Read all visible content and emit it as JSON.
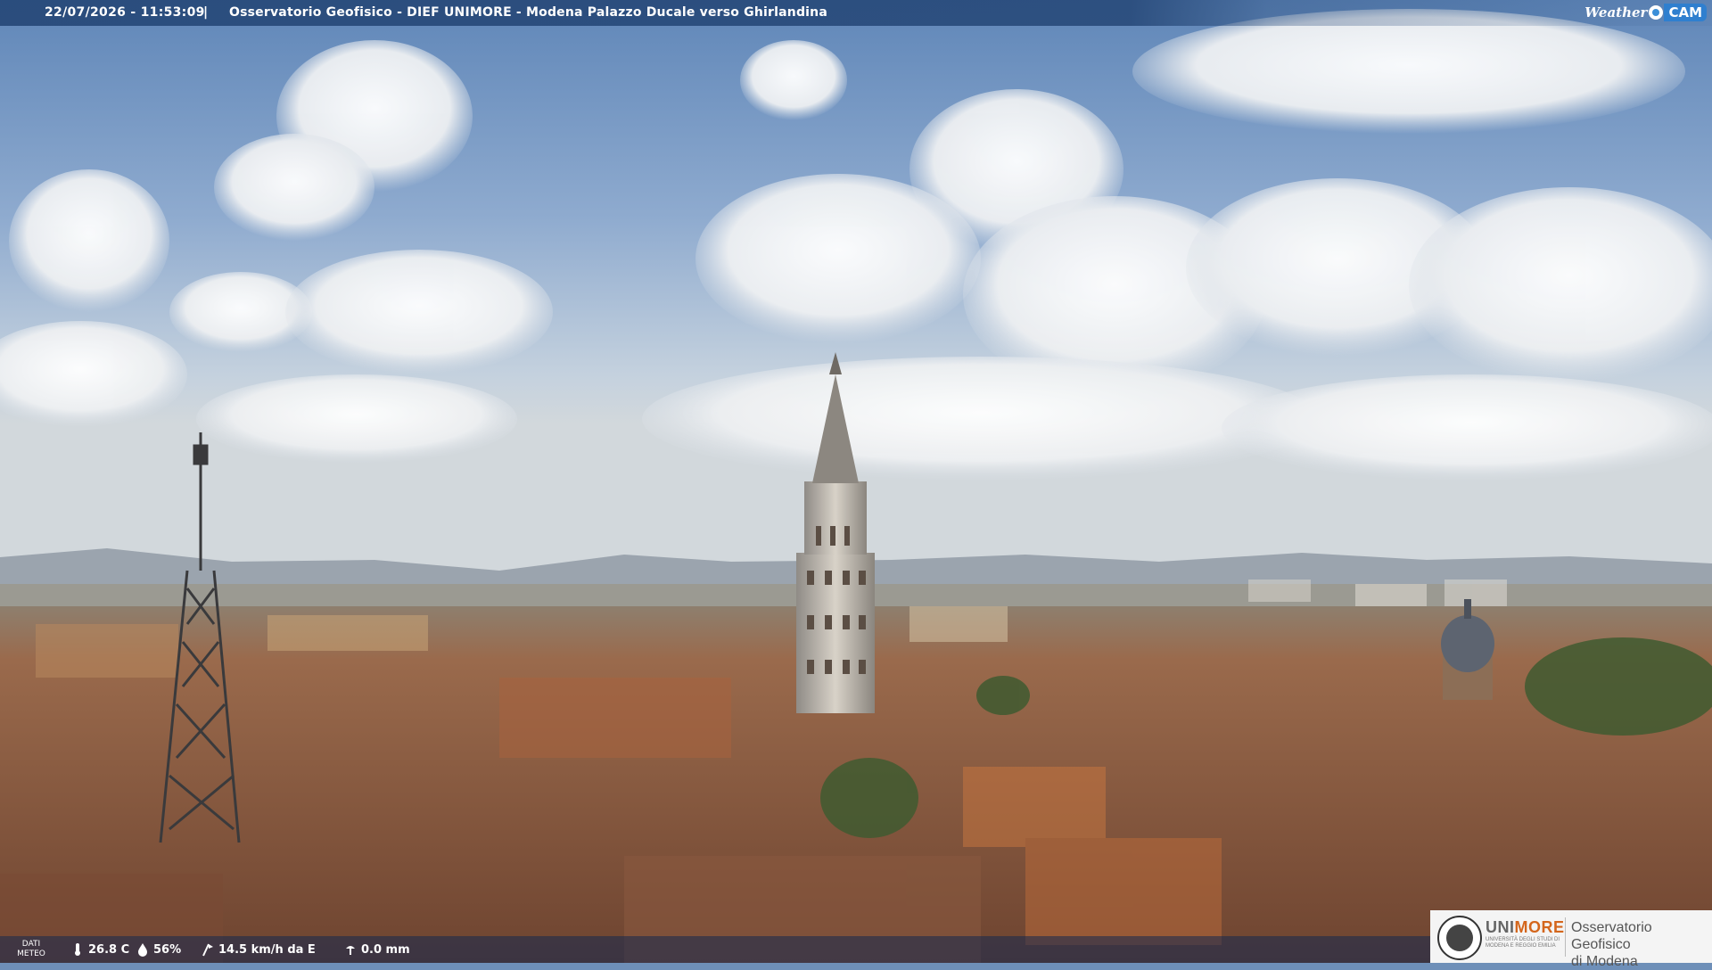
{
  "header": {
    "datetime": "22/07/2026 - 11:53:09",
    "separator": "|",
    "title": "Osservatorio Geofisico - DIEF UNIMORE - Modena Palazzo Ducale verso Ghirlandina",
    "brand_weather": "Weather",
    "brand_cam": "CAM"
  },
  "meteo": {
    "label_line1": "DATI",
    "label_line2": "METEO",
    "temperature": "26.8 C",
    "humidity": "56%",
    "wind": "14.5 km/h da E",
    "rain": "0.0 mm",
    "icons": [
      "thermometer-icon",
      "humidity-drop-icon",
      "wind-icon",
      "rain-gauge-icon"
    ]
  },
  "logo": {
    "uni_part1": "UNI",
    "uni_part2": "MORE",
    "uni_sub": "UNIVERSITÀ DEGLI STUDI DI MODENA E REGGIO EMILIA",
    "observatory_line1": "Osservatorio Geofisico",
    "observatory_line2": "di Modena"
  },
  "colors": {
    "header_bar": "#264878",
    "accent_orange": "#d4661c",
    "cam_blue": "#2f7fcf"
  }
}
